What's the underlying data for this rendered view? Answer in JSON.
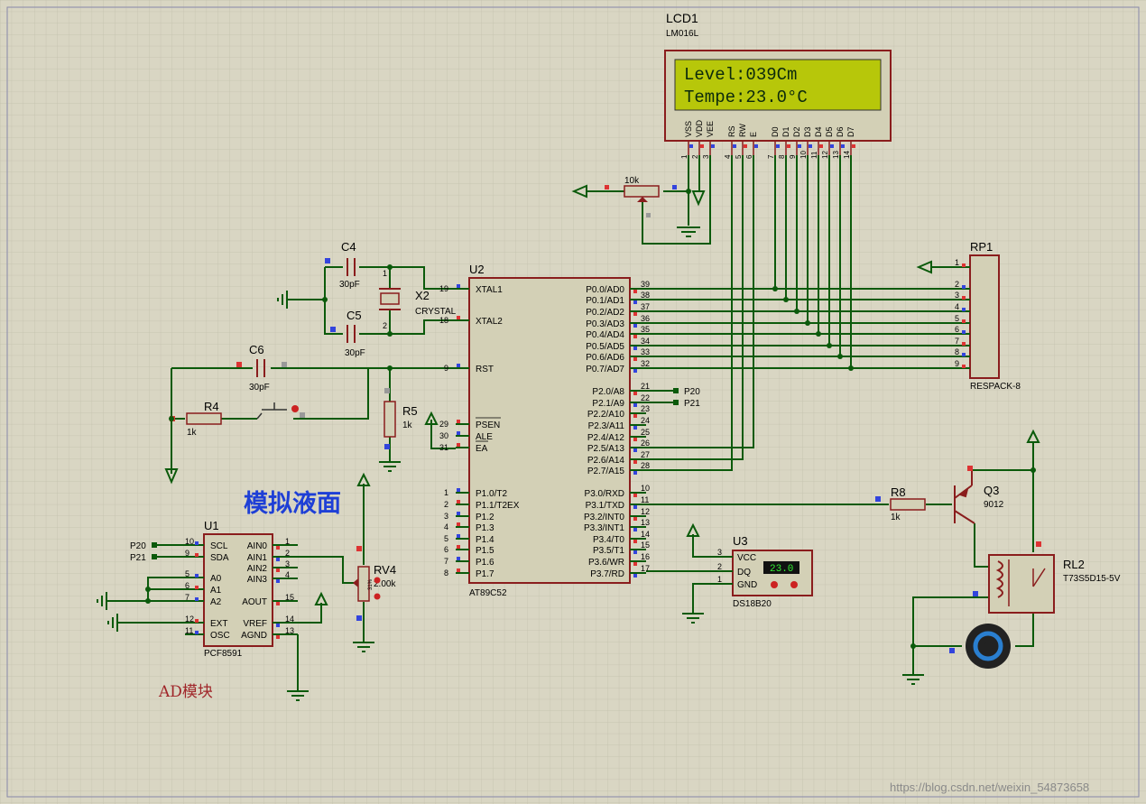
{
  "colors": {
    "background": "#d9d6c3",
    "wire": "#0b5a0b",
    "body": "#d3d0b6",
    "body_stroke": "#8a1d1d",
    "lcd_screen": "#b7c70a",
    "lcd_text": "#0c2a0c",
    "label_red": "#cc2222",
    "label_blue": "#2244cc",
    "heading_blue": "#1e3fd6",
    "ad_label": "#a0262a"
  },
  "lcd": {
    "ref": "LCD1",
    "part": "LM016L",
    "line1": "Level:039Cm",
    "line2": "Tempe:23.0°C",
    "pin_names": [
      "VSS",
      "VDD",
      "VEE",
      "RS",
      "RW",
      "E",
      "D0",
      "D1",
      "D2",
      "D3",
      "D4",
      "D5",
      "D6",
      "D7"
    ],
    "pin_numbers": [
      "1",
      "2",
      "3",
      "4",
      "5",
      "6",
      "7",
      "8",
      "9",
      "10",
      "11",
      "12",
      "13",
      "14"
    ]
  },
  "pot_contrast": {
    "value": "10k"
  },
  "mcu": {
    "ref": "U2",
    "part": "AT89C52",
    "left_pins": [
      {
        "num": "19",
        "name": "XTAL1"
      },
      {
        "num": "18",
        "name": "XTAL2"
      },
      {
        "num": "9",
        "name": "RST"
      },
      {
        "num": "29",
        "name": "PSEN"
      },
      {
        "num": "30",
        "name": "ALE"
      },
      {
        "num": "31",
        "name": "EA"
      },
      {
        "num": "1",
        "name": "P1.0/T2"
      },
      {
        "num": "2",
        "name": "P1.1/T2EX"
      },
      {
        "num": "3",
        "name": "P1.2"
      },
      {
        "num": "4",
        "name": "P1.3"
      },
      {
        "num": "5",
        "name": "P1.4"
      },
      {
        "num": "6",
        "name": "P1.5"
      },
      {
        "num": "7",
        "name": "P1.6"
      },
      {
        "num": "8",
        "name": "P1.7"
      }
    ],
    "right_pins": [
      {
        "num": "39",
        "name": "P0.0/AD0"
      },
      {
        "num": "38",
        "name": "P0.1/AD1"
      },
      {
        "num": "37",
        "name": "P0.2/AD2"
      },
      {
        "num": "36",
        "name": "P0.3/AD3"
      },
      {
        "num": "35",
        "name": "P0.4/AD4"
      },
      {
        "num": "34",
        "name": "P0.5/AD5"
      },
      {
        "num": "33",
        "name": "P0.6/AD6"
      },
      {
        "num": "32",
        "name": "P0.7/AD7"
      },
      {
        "num": "21",
        "name": "P2.0/A8"
      },
      {
        "num": "22",
        "name": "P2.1/A9"
      },
      {
        "num": "23",
        "name": "P2.2/A10"
      },
      {
        "num": "24",
        "name": "P2.3/A11"
      },
      {
        "num": "25",
        "name": "P2.4/A12"
      },
      {
        "num": "26",
        "name": "P2.5/A13"
      },
      {
        "num": "27",
        "name": "P2.6/A14"
      },
      {
        "num": "28",
        "name": "P2.7/A15"
      },
      {
        "num": "10",
        "name": "P3.0/RXD"
      },
      {
        "num": "11",
        "name": "P3.1/TXD"
      },
      {
        "num": "12",
        "name": "P3.2/INT0"
      },
      {
        "num": "13",
        "name": "P3.3/INT1"
      },
      {
        "num": "14",
        "name": "P3.4/T0"
      },
      {
        "num": "15",
        "name": "P3.5/T1"
      },
      {
        "num": "16",
        "name": "P3.6/WR"
      },
      {
        "num": "17",
        "name": "P3.7/RD"
      }
    ]
  },
  "net_labels": {
    "p20": "P20",
    "p21": "P21"
  },
  "rp1": {
    "ref": "RP1",
    "part": "RESPACK-8",
    "pins": [
      "1",
      "2",
      "3",
      "4",
      "5",
      "6",
      "7",
      "8",
      "9"
    ]
  },
  "c4": {
    "ref": "C4",
    "value": "30pF"
  },
  "c5": {
    "ref": "C5",
    "value": "30pF"
  },
  "c6": {
    "ref": "C6",
    "value": "30pF"
  },
  "x2": {
    "ref": "X2",
    "part": "CRYSTAL",
    "pin1": "1",
    "pin2": "2"
  },
  "r4": {
    "ref": "R4",
    "value": "1k"
  },
  "r5": {
    "ref": "R5",
    "value": "1k"
  },
  "r8": {
    "ref": "R8",
    "value": "1k"
  },
  "q3": {
    "ref": "Q3",
    "part": "9012"
  },
  "rl2": {
    "ref": "RL2",
    "part": "T73S5D15-5V"
  },
  "u3": {
    "ref": "U3",
    "part": "DS18B20",
    "display": "23.0",
    "pins": [
      {
        "num": "3",
        "name": "VCC"
      },
      {
        "num": "2",
        "name": "DQ"
      },
      {
        "num": "1",
        "name": "GND"
      }
    ]
  },
  "u1": {
    "ref": "U1",
    "part": "PCF8591",
    "left_pins": [
      {
        "num": "10",
        "name": "SCL"
      },
      {
        "num": "9",
        "name": "SDA"
      },
      {
        "num": "5",
        "name": "A0"
      },
      {
        "num": "6",
        "name": "A1"
      },
      {
        "num": "7",
        "name": "A2"
      },
      {
        "num": "12",
        "name": "EXT"
      },
      {
        "num": "11",
        "name": "OSC"
      }
    ],
    "right_pins": [
      {
        "num": "1",
        "name": "AIN0"
      },
      {
        "num": "2",
        "name": "AIN1"
      },
      {
        "num": "3",
        "name": "AIN2"
      },
      {
        "num": "4",
        "name": "AIN3"
      },
      {
        "num": "15",
        "name": "AOUT"
      },
      {
        "num": "14",
        "name": "VREF"
      },
      {
        "num": "13",
        "name": "AGND"
      }
    ]
  },
  "rv4": {
    "ref": "RV4",
    "value": "2.00k",
    "percent": "31%"
  },
  "headings": {
    "analog_level": "模拟液面",
    "ad_module": "AD模块"
  },
  "watermark": "https://blog.csdn.net/weixin_54873658"
}
